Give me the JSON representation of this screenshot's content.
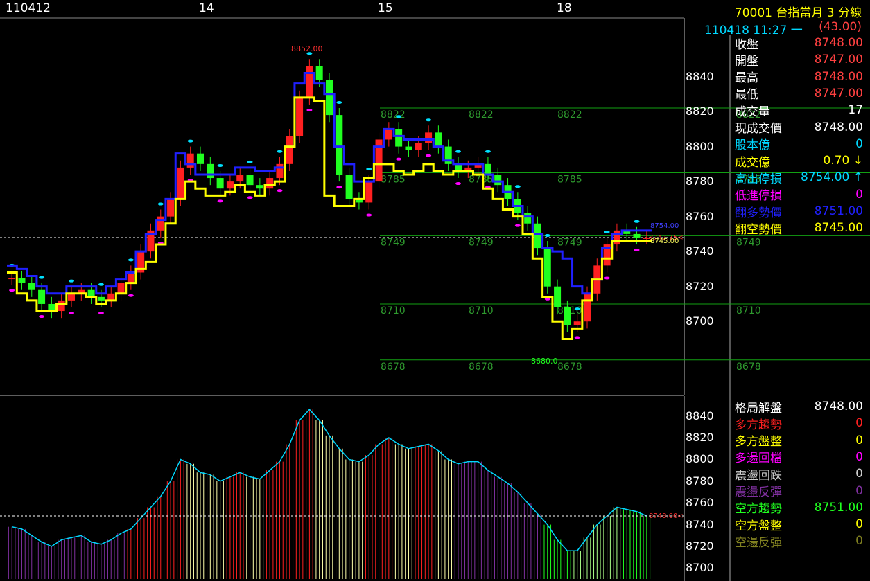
{
  "header": {
    "date_labels": [
      "110412",
      "14",
      "15",
      "18"
    ],
    "instrument": "70001  台指當月 3 分線",
    "timestamp": "110418 11:27 一",
    "change": "(43.00)"
  },
  "quote_panel": [
    {
      "label": "收盤",
      "value": "8748.00",
      "label_color": "#ffffff",
      "value_color": "#ff4040"
    },
    {
      "label": "開盤",
      "value": "8747.00",
      "label_color": "#ffffff",
      "value_color": "#ff4040"
    },
    {
      "label": "最高",
      "value": "8748.00",
      "label_color": "#ffffff",
      "value_color": "#ff4040"
    },
    {
      "label": "最低",
      "value": "8747.00",
      "label_color": "#ffffff",
      "value_color": "#ff4040"
    },
    {
      "label": "成交量",
      "value": "17",
      "label_color": "#ffffff",
      "value_color": "#ffffff"
    },
    {
      "label": "現成交價",
      "value": "8748.00",
      "label_color": "#ffffff",
      "value_color": "#ffffff"
    },
    {
      "label": "股本億",
      "value": "0",
      "label_color": "#00d8ff",
      "value_color": "#00d8ff"
    },
    {
      "label": "成交億",
      "value": "0.70  ↓",
      "label_color": "#ffff00",
      "value_color": "#ffff00"
    },
    {
      "label": "高出停損",
      "value": "8754.00  ↑",
      "label_color": "#00d8ff",
      "value_color": "#00d8ff"
    },
    {
      "label": "低進停損",
      "value": "0",
      "label_color": "#ff00ff",
      "value_color": "#ff00ff"
    },
    {
      "label": "翻多勢價",
      "value": "8751.00",
      "label_color": "#2020ff",
      "value_color": "#2020ff"
    },
    {
      "label": "翻空勢價",
      "value": "8745.00",
      "label_color": "#ffff00",
      "value_color": "#ffff00"
    }
  ],
  "pattern_panel": [
    {
      "label": "格局解盤",
      "value": "8748.00",
      "label_color": "#ffffff",
      "value_color": "#ffffff"
    },
    {
      "label": "多方趨勢",
      "value": "0",
      "label_color": "#ff2020",
      "value_color": "#ff2020"
    },
    {
      "label": "多方盤整",
      "value": "0",
      "label_color": "#ffff00",
      "value_color": "#ffff00"
    },
    {
      "label": "多逿回檔",
      "value": "0",
      "label_color": "#ff00ff",
      "value_color": "#ff00ff"
    },
    {
      "label": "震盪回跌",
      "value": "0",
      "label_color": "#d0d0d0",
      "value_color": "#d0d0d0"
    },
    {
      "label": "震盪反彈",
      "value": "0",
      "label_color": "#8030a0",
      "value_color": "#8030a0"
    },
    {
      "label": "空方趨勢",
      "value": "8751.00",
      "label_color": "#20ff20",
      "value_color": "#20ff20"
    },
    {
      "label": "空方盤整",
      "value": "0",
      "label_color": "#ffff00",
      "value_color": "#ffff00"
    },
    {
      "label": "空逿反彈",
      "value": "0",
      "label_color": "#808020",
      "value_color": "#808020"
    }
  ],
  "chart_data": [
    {
      "type": "candlestick",
      "y_ticks": [
        8840,
        8820,
        8800,
        8780,
        8760,
        8740,
        8720,
        8700
      ],
      "ylim": [
        8670,
        8860
      ],
      "x_labels": [
        "110412",
        "14",
        "15",
        "18"
      ],
      "high_label": "8852.00",
      "low_label": "8680.0",
      "current_label": "8747.75",
      "right_edge_labels": [
        "8754.00",
        "8745.00"
      ],
      "support_resistance_levels": [
        8822,
        8785,
        8749,
        8710,
        8678
      ],
      "current_price": 8748,
      "series": [
        {
          "name": "close",
          "color_up": "#ff2020",
          "color_down": "#20ff20",
          "values": [
            8725,
            8722,
            8718,
            8710,
            8706,
            8712,
            8716,
            8718,
            8714,
            8712,
            8716,
            8722,
            8728,
            8740,
            8752,
            8760,
            8770,
            8788,
            8796,
            8790,
            8782,
            8776,
            8780,
            8784,
            8778,
            8776,
            8782,
            8790,
            8806,
            8828,
            8846,
            8838,
            8818,
            8784,
            8770,
            8768,
            8780,
            8804,
            8810,
            8800,
            8798,
            8802,
            8808,
            8800,
            8790,
            8786,
            8788,
            8790,
            8784,
            8778,
            8770,
            8762,
            8756,
            8742,
            8720,
            8708,
            8698,
            8700,
            8716,
            8732,
            8744,
            8752,
            8750,
            8748,
            8748
          ]
        },
        {
          "name": "blue-trend",
          "color": "#2020ff",
          "values": [
            8732,
            8730,
            8726,
            8720,
            8716,
            8716,
            8720,
            8720,
            8720,
            8716,
            8720,
            8724,
            8728,
            8740,
            8750,
            8758,
            8770,
            8796,
            8790,
            8784,
            8784,
            8784,
            8784,
            8788,
            8788,
            8786,
            8786,
            8788,
            8800,
            8836,
            8842,
            8836,
            8830,
            8800,
            8790,
            8780,
            8780,
            8800,
            8810,
            8806,
            8804,
            8804,
            8804,
            8800,
            8792,
            8790,
            8790,
            8790,
            8784,
            8780,
            8774,
            8766,
            8760,
            8750,
            8742,
            8740,
            8736,
            8720,
            8716,
            8724,
            8742,
            8750,
            8752,
            8752,
            8752
          ]
        },
        {
          "name": "yellow-trend",
          "color": "#ffff00",
          "values": [
            8728,
            8716,
            8712,
            8706,
            8706,
            8710,
            8716,
            8716,
            8714,
            8710,
            8712,
            8716,
            8722,
            8730,
            8734,
            8744,
            8756,
            8770,
            8780,
            8776,
            8772,
            8772,
            8774,
            8778,
            8774,
            8772,
            8778,
            8780,
            8800,
            8828,
            8828,
            8826,
            8772,
            8766,
            8766,
            8770,
            8782,
            8790,
            8790,
            8786,
            8784,
            8786,
            8790,
            8786,
            8784,
            8786,
            8786,
            8784,
            8776,
            8770,
            8764,
            8760,
            8750,
            8736,
            8714,
            8700,
            8690,
            8696,
            8712,
            8724,
            8736,
            8746,
            8746,
            8746,
            8746
          ]
        }
      ]
    },
    {
      "type": "bar",
      "y_ticks": [
        8840,
        8820,
        8800,
        8780,
        8760,
        8740,
        8720,
        8700
      ],
      "ylim": [
        8690,
        8850
      ],
      "current_label": "8748.00",
      "series": [
        {
          "name": "price-line",
          "color": "#00d8ff",
          "values": [
            8738,
            8736,
            8730,
            8724,
            8720,
            8726,
            8728,
            8730,
            8724,
            8722,
            8726,
            8732,
            8736,
            8746,
            8756,
            8766,
            8780,
            8800,
            8796,
            8788,
            8786,
            8780,
            8784,
            8788,
            8784,
            8782,
            8790,
            8798,
            8814,
            8836,
            8846,
            8836,
            8822,
            8810,
            8800,
            8798,
            8804,
            8814,
            8820,
            8814,
            8810,
            8812,
            8814,
            8808,
            8800,
            8796,
            8798,
            8798,
            8790,
            8784,
            8778,
            8770,
            8760,
            8750,
            8740,
            8726,
            8716,
            8716,
            8728,
            8740,
            8748,
            8756,
            8754,
            8752,
            8748
          ]
        }
      ]
    }
  ]
}
